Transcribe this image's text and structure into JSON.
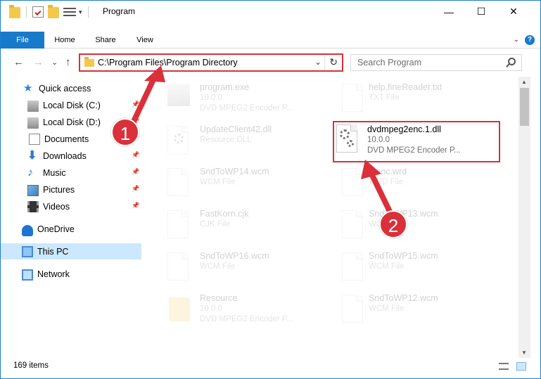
{
  "window": {
    "title": "Program",
    "minimize": "—",
    "maximize": "☐",
    "close": "✕"
  },
  "ribbon": {
    "tabs": [
      "File",
      "Home",
      "Share",
      "View"
    ],
    "help": "?",
    "collapse": "⌄"
  },
  "nav": {
    "back": "←",
    "forward": "→",
    "recent": "⌄",
    "up": "↑",
    "address": "C:\\Program Files\\Program Directory",
    "address_chevron": "⌄",
    "refresh": "↻",
    "search_placeholder": "Search Program"
  },
  "sidebar": {
    "items": [
      {
        "label": "Quick access",
        "icon": "star-icon"
      },
      {
        "label": "Local Disk (C:)",
        "icon": "drive-icon"
      },
      {
        "label": "Local Disk (D:)",
        "icon": "drive-icon"
      },
      {
        "label": "Documents",
        "icon": "documents-icon"
      },
      {
        "label": "Downloads",
        "icon": "download-icon"
      },
      {
        "label": "Music",
        "icon": "music-icon"
      },
      {
        "label": "Pictures",
        "icon": "pictures-icon"
      },
      {
        "label": "Videos",
        "icon": "videos-icon"
      },
      {
        "label": "OneDrive",
        "icon": "onedrive-icon"
      },
      {
        "label": "This PC",
        "icon": "computer-icon"
      },
      {
        "label": "Network",
        "icon": "network-icon"
      }
    ],
    "pin": "📌"
  },
  "files": [
    {
      "name": "program.exe",
      "line2": "10.0.0",
      "line3": "DVD MPEG2 Encoder P..."
    },
    {
      "name": "help.fineReader.txt",
      "line2": "TXT File",
      "line3": ""
    },
    {
      "name": "UpdateClient42.dll",
      "line2": "Resource DLL",
      "line3": ""
    },
    {
      "name": "dvdmpeg2enc.1.dll",
      "line2": "10.0.0",
      "line3": "DVD MPEG2 Encoder P..."
    },
    {
      "name": "SndToWP14.wcm",
      "line2": "WCM File",
      "line3": ""
    },
    {
      "name": "...enc.wrd",
      "line2": "WRD File",
      "line3": ""
    },
    {
      "name": "FastKorn.cjk",
      "line2": "CJK File",
      "line3": ""
    },
    {
      "name": "SndToWP13.wcm",
      "line2": "WCM File",
      "line3": ""
    },
    {
      "name": "SndToWP16.wcm",
      "line2": "WCM File",
      "line3": ""
    },
    {
      "name": "SndToWP15.wcm",
      "line2": "WCM File",
      "line3": ""
    },
    {
      "name": "Resource",
      "line2": "10.0.0",
      "line3": "DVD MPEG2 Encoder P..."
    },
    {
      "name": "SndToWP12.wcm",
      "line2": "WCM File",
      "line3": ""
    }
  ],
  "status": {
    "items_count": "169 items"
  },
  "annotations": {
    "step1": "1",
    "step2": "2",
    "color": "#d9303a"
  }
}
